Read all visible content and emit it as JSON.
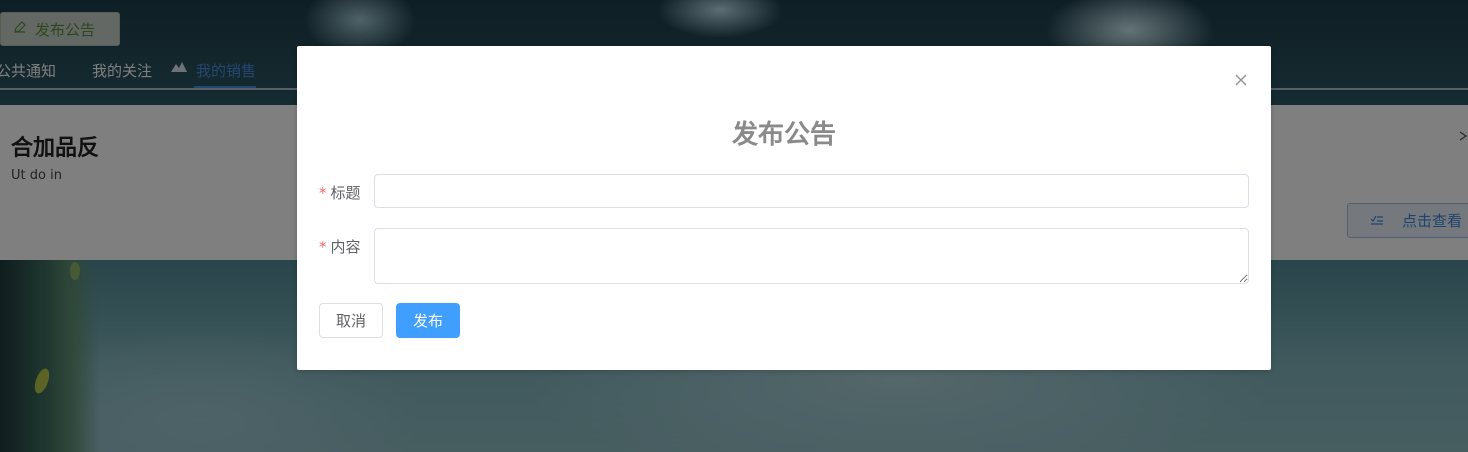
{
  "header": {
    "publish_button_label": "发布公告",
    "tabs": [
      {
        "label": "公共通知"
      },
      {
        "label": "我的关注"
      },
      {
        "label": "我的销售"
      }
    ],
    "active_tab_index": 2
  },
  "background_card": {
    "title": "合加品反",
    "subtitle": "Ut do in",
    "view_button_label": "点击查看"
  },
  "modal": {
    "title": "发布公告",
    "close_icon": "close-icon",
    "fields": {
      "title_label": "标题",
      "title_value": "",
      "content_label": "内容",
      "content_value": "",
      "required_mark": "*"
    },
    "cancel_label": "取消",
    "submit_label": "发布"
  },
  "colors": {
    "primary": "#409eff",
    "required": "#f56c6c",
    "active_tab": "#4a8de0",
    "publish_green": "#6a9a3a"
  }
}
